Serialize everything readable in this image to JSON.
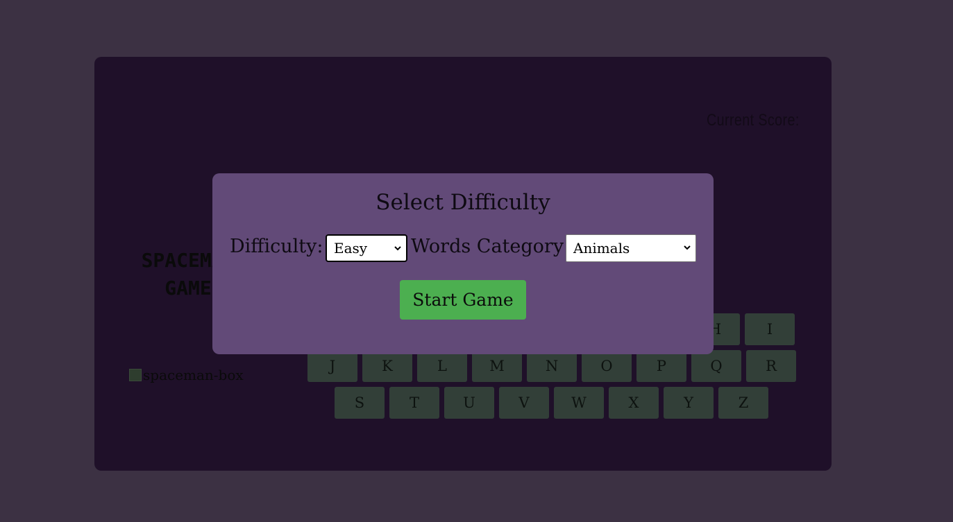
{
  "score": {
    "label": "Current Score:"
  },
  "title": {
    "line1": "SPACEMAN",
    "line2": "GAME"
  },
  "image": {
    "alt": "spaceman-box",
    "icon": "broken-image-icon"
  },
  "keyboard": {
    "row1_visible": [
      "H",
      "I"
    ],
    "row2": [
      "J",
      "K",
      "L",
      "M",
      "N",
      "O",
      "P",
      "Q",
      "R"
    ],
    "row3": [
      "S",
      "T",
      "U",
      "V",
      "W",
      "X",
      "Y",
      "Z"
    ]
  },
  "modal": {
    "title": "Select Difficulty",
    "difficulty_label": "Difficulty:",
    "difficulty_value": "Easy",
    "category_label": "Words Category:",
    "category_value": "Animals",
    "start_label": "Start Game"
  },
  "colors": {
    "page_bg": "#3c3143",
    "panel_bg": "#1f1029",
    "modal_bg": "#624a78",
    "key_bg": "#323f38",
    "start_button": "#4caf50"
  }
}
